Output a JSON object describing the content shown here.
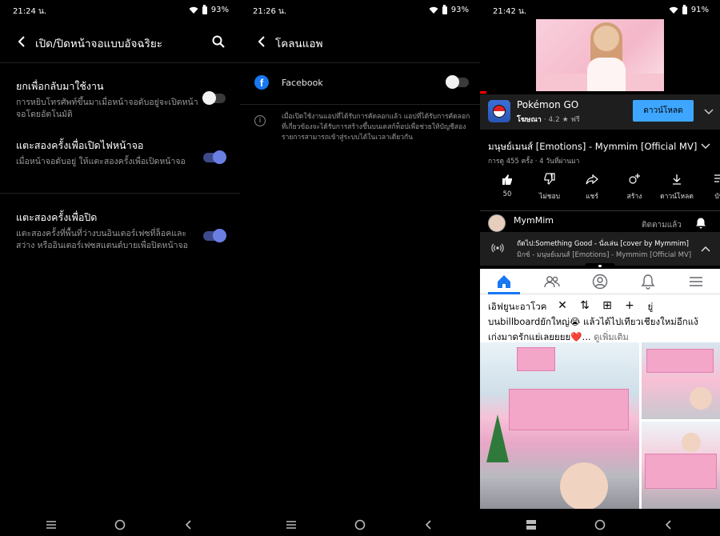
{
  "panel1": {
    "status": {
      "time": "21:24 น.",
      "battery": "93%"
    },
    "title": "เปิด/ปิดหน้าจอแบบอัจฉริยะ",
    "settings": [
      {
        "title": "ยกเพื่อกลับมาใช้งาน",
        "desc": "การหยิบโทรศัพท์ขึ้นมาเมื่อหน้าจอดับอยู่จะเปิดหน้าจอโดยอัตโนมัติ",
        "enabled": false
      },
      {
        "title": "แตะสองครั้งเพื่อเปิดไฟหน้าจอ",
        "desc": "เมื่อหน้าจอดับอยู่ ให้แตะสองครั้งเพื่อเปิดหน้าจอ",
        "enabled": true
      },
      {
        "title": "แตะสองครั้งเพื่อปิด",
        "desc": "แตะสองครั้งที่พื้นที่ว่างบนอินเตอร์เฟซที่ล็อคและสว่าง หรืออินเตอร์เฟซสแตนด์บายเพื่อปิดหน้าจอ",
        "enabled": true
      }
    ]
  },
  "panel2": {
    "status": {
      "time": "21:26 น.",
      "battery": "93%"
    },
    "title": "โคลนแอพ",
    "app": {
      "name": "Facebook",
      "enabled": false
    },
    "info": "เมื่อเปิดใช้งานแอปที่ได้รับการคัดลอกแล้ว แอปที่ได้รับการคัดลอกที่เกี่ยวข้องจะได้รับการสร้างขึ้นบนเดสก์ท็อปเพื่อช่วยให้บัญชีสองรายการสามารถเข้าสู่ระบบได้ในเวลาเดียวกัน"
  },
  "panel3": {
    "status": {
      "time": "21:42 น.",
      "battery": "91%"
    },
    "ad": {
      "title": "Pokémon GO",
      "label": "โฆษณา",
      "rating": "4.2 ★",
      "price": "ฟรี",
      "button": "ดาวน์โหลด"
    },
    "video": {
      "title": "มนุษย์เมนส์ [Emotions] - Mymmim [Official MV]",
      "meta": "การดู 455 ครั้ง · 4 วันที่ผ่านมา"
    },
    "actions": [
      {
        "label": "50",
        "icon": "thumbs-up-icon"
      },
      {
        "label": "ไม่ชอบ",
        "icon": "thumbs-down-icon"
      },
      {
        "label": "แชร์",
        "icon": "share-icon"
      },
      {
        "label": "สร้าง",
        "icon": "remix-icon"
      },
      {
        "label": "ดาวน์โหลด",
        "icon": "download-icon"
      },
      {
        "label": "บัน",
        "icon": "save-icon"
      }
    ],
    "channel": {
      "name": "MymMim",
      "subscribe": "ติดตามแล้ว"
    },
    "up_next": {
      "line1": "ถัดไป:Something Good - นั่งเล่น [cover by Mymmim]",
      "line2": "มิกซ์ - มนุษย์เมนส์ [Emotions] - Mymmim [Official MV]"
    },
    "fb_post": {
      "line1": "เอิฟยูนะอาโวค",
      "line1b": "ยู่",
      "line2": "บนbillboardยักใหญ่😭 แล้วได้ไปเทียวเชียงใหม่อีกแง้",
      "line3": "เก่งมาดรักแย่เลยยยย❤️...",
      "see_more": "ดูเพิ่มเติม"
    },
    "split_tools": [
      "✕",
      "⇅",
      "⊞",
      "+"
    ]
  },
  "colors": {
    "toggle_on": "#6b7fe3",
    "fb_blue": "#1877f2",
    "yt_download": "#3ea6ff"
  }
}
